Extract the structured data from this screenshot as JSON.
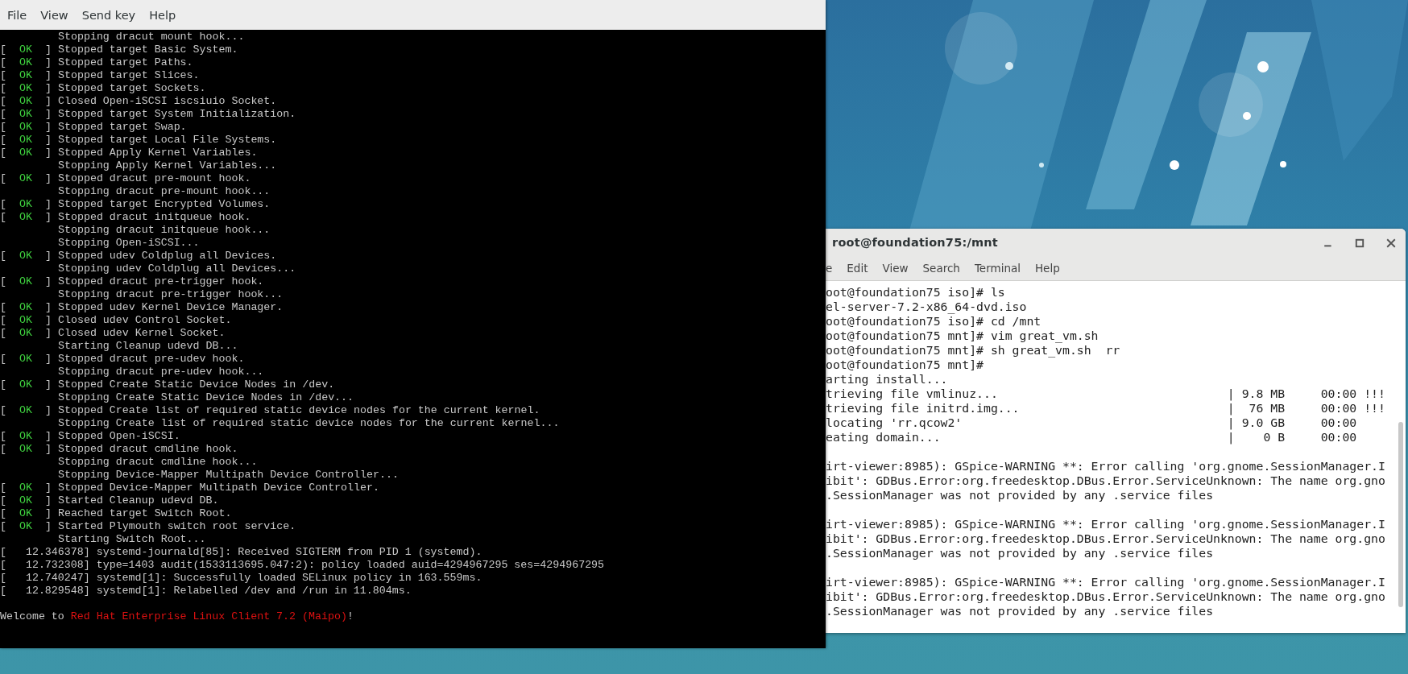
{
  "console_window": {
    "menu": [
      {
        "label": "File"
      },
      {
        "label": "View"
      },
      {
        "label": "Send key"
      },
      {
        "label": "Help"
      }
    ],
    "lines": [
      {
        "kind": "plain",
        "text": "Stopping dracut mount hook..."
      },
      {
        "kind": "status",
        "open": "[",
        "status": "OK",
        "close": "]",
        "text": "Stopped target Basic System."
      },
      {
        "kind": "status",
        "open": "[",
        "status": "OK",
        "close": "]",
        "text": "Stopped target Paths."
      },
      {
        "kind": "status",
        "open": "[",
        "status": "OK",
        "close": "]",
        "text": "Stopped target Slices."
      },
      {
        "kind": "status",
        "open": "[",
        "status": "OK",
        "close": "]",
        "text": "Stopped target Sockets."
      },
      {
        "kind": "status",
        "open": "[",
        "status": "OK",
        "close": "]",
        "text": "Closed Open-iSCSI iscsiuio Socket."
      },
      {
        "kind": "status",
        "open": "[",
        "status": "OK",
        "close": "]",
        "text": "Stopped target System Initialization."
      },
      {
        "kind": "status",
        "open": "[",
        "status": "OK",
        "close": "]",
        "text": "Stopped target Swap."
      },
      {
        "kind": "status",
        "open": "[",
        "status": "OK",
        "close": "]",
        "text": "Stopped target Local File Systems."
      },
      {
        "kind": "status",
        "open": "[",
        "status": "OK",
        "close": "]",
        "text": "Stopped Apply Kernel Variables."
      },
      {
        "kind": "plain",
        "text": "Stopping Apply Kernel Variables..."
      },
      {
        "kind": "status",
        "open": "[",
        "status": "OK",
        "close": "]",
        "text": "Stopped dracut pre-mount hook."
      },
      {
        "kind": "plain",
        "text": "Stopping dracut pre-mount hook..."
      },
      {
        "kind": "status",
        "open": "[",
        "status": "OK",
        "close": "]",
        "text": "Stopped target Encrypted Volumes."
      },
      {
        "kind": "status",
        "open": "[",
        "status": "OK",
        "close": "]",
        "text": "Stopped dracut initqueue hook."
      },
      {
        "kind": "plain",
        "text": "Stopping dracut initqueue hook..."
      },
      {
        "kind": "plain",
        "text": "Stopping Open-iSCSI..."
      },
      {
        "kind": "status",
        "open": "[",
        "status": "OK",
        "close": "]",
        "text": "Stopped udev Coldplug all Devices."
      },
      {
        "kind": "plain",
        "text": "Stopping udev Coldplug all Devices..."
      },
      {
        "kind": "status",
        "open": "[",
        "status": "OK",
        "close": "]",
        "text": "Stopped dracut pre-trigger hook."
      },
      {
        "kind": "plain",
        "text": "Stopping dracut pre-trigger hook..."
      },
      {
        "kind": "status",
        "open": "[",
        "status": "OK",
        "close": "]",
        "text": "Stopped udev Kernel Device Manager."
      },
      {
        "kind": "status",
        "open": "[",
        "status": "OK",
        "close": "]",
        "text": "Closed udev Control Socket."
      },
      {
        "kind": "status",
        "open": "[",
        "status": "OK",
        "close": "]",
        "text": "Closed udev Kernel Socket."
      },
      {
        "kind": "plain",
        "text": "Starting Cleanup udevd DB..."
      },
      {
        "kind": "status",
        "open": "[",
        "status": "OK",
        "close": "]",
        "text": "Stopped dracut pre-udev hook."
      },
      {
        "kind": "plain",
        "text": "Stopping dracut pre-udev hook..."
      },
      {
        "kind": "status",
        "open": "[",
        "status": "OK",
        "close": "]",
        "text": "Stopped Create Static Device Nodes in /dev."
      },
      {
        "kind": "plain",
        "text": "Stopping Create Static Device Nodes in /dev..."
      },
      {
        "kind": "status",
        "open": "[",
        "status": "OK",
        "close": "]",
        "text": "Stopped Create list of required static device nodes for the current kernel."
      },
      {
        "kind": "plain",
        "text": "Stopping Create list of required static device nodes for the current kernel..."
      },
      {
        "kind": "status",
        "open": "[",
        "status": "OK",
        "close": "]",
        "text": "Stopped Open-iSCSI."
      },
      {
        "kind": "status",
        "open": "[",
        "status": "OK",
        "close": "]",
        "text": "Stopped dracut cmdline hook."
      },
      {
        "kind": "plain",
        "text": "Stopping dracut cmdline hook..."
      },
      {
        "kind": "plain",
        "text": "Stopping Device-Mapper Multipath Device Controller..."
      },
      {
        "kind": "status",
        "open": "[",
        "status": "OK",
        "close": "]",
        "text": "Stopped Device-Mapper Multipath Device Controller."
      },
      {
        "kind": "status",
        "open": "[",
        "status": "OK",
        "close": "]",
        "text": "Started Cleanup udevd DB."
      },
      {
        "kind": "status",
        "open": "[",
        "status": "OK",
        "close": "]",
        "text": "Reached target Switch Root."
      },
      {
        "kind": "status",
        "open": "[",
        "status": "OK",
        "close": "]",
        "text": "Started Plymouth switch root service."
      },
      {
        "kind": "plain",
        "text": "Starting Switch Root..."
      },
      {
        "kind": "kernel",
        "text": "[   12.346378] systemd-journald[85]: Received SIGTERM from PID 1 (systemd)."
      },
      {
        "kind": "kernel",
        "text": "[   12.732308] type=1403 audit(1533113695.047:2): policy loaded auid=4294967295 ses=4294967295"
      },
      {
        "kind": "kernel",
        "text": "[   12.740247] systemd[1]: Successfully loaded SELinux policy in 163.559ms."
      },
      {
        "kind": "kernel",
        "text": "[   12.829548] systemd[1]: Relabelled /dev and /run in 11.804ms."
      },
      {
        "kind": "welcome",
        "text": "Welcome to ",
        "highlight": "Red Hat Enterprise Linux Client 7.2 (Maipo)",
        "tail": "!"
      }
    ]
  },
  "terminal_window": {
    "title": "root@foundation75:/mnt",
    "menu": [
      {
        "label": "e"
      },
      {
        "label": "Edit"
      },
      {
        "label": "View"
      },
      {
        "label": "Search"
      },
      {
        "label": "Terminal"
      },
      {
        "label": "Help"
      }
    ],
    "blocks": [
      [
        "oot@foundation75 iso]# ls",
        "el-server-7.2-x86_64-dvd.iso",
        "oot@foundation75 iso]# cd /mnt",
        "oot@foundation75 mnt]# vim great_vm.sh",
        "oot@foundation75 mnt]# sh great_vm.sh  rr",
        "oot@foundation75 mnt]#",
        "arting install...",
        "trieving file vmlinuz...                                | 9.8 MB     00:00 !!!",
        "trieving file initrd.img...                             |  76 MB     00:00 !!!",
        "locating 'rr.qcow2'                                     | 9.0 GB     00:00",
        "eating domain...                                        |    0 B     00:00"
      ],
      [
        "irt-viewer:8985): GSpice-WARNING **: Error calling 'org.gnome.SessionManager.I",
        "ibit': GDBus.Error:org.freedesktop.DBus.Error.ServiceUnknown: The name org.gno",
        ".SessionManager was not provided by any .service files"
      ],
      [
        "irt-viewer:8985): GSpice-WARNING **: Error calling 'org.gnome.SessionManager.I",
        "ibit': GDBus.Error:org.freedesktop.DBus.Error.ServiceUnknown: The name org.gno",
        ".SessionManager was not provided by any .service files"
      ],
      [
        "irt-viewer:8985): GSpice-WARNING **: Error calling 'org.gnome.SessionManager.I",
        "ibit': GDBus.Error:org.freedesktop.DBus.Error.ServiceUnknown: The name org.gno",
        ".SessionManager was not provided by any .service files"
      ]
    ]
  }
}
